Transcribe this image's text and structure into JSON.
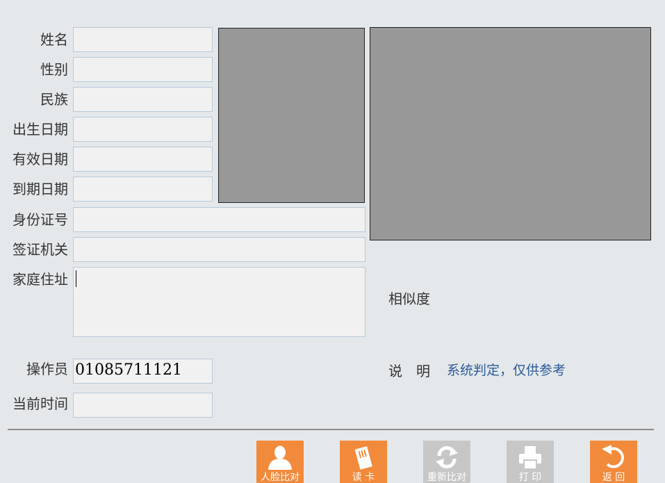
{
  "form": {
    "name_label": "姓名",
    "gender_label": "性别",
    "ethnicity_label": "民族",
    "birth_label": "出生日期",
    "valid_label": "有效日期",
    "expiry_label": "到期日期",
    "id_label": "身份证号",
    "issuer_label": "签证机关",
    "address_label": "家庭住址",
    "operator_label": "操作员",
    "operator_value": "01085711121",
    "time_label": "当前时间"
  },
  "compare": {
    "similarity_label": "相似度",
    "note_label": "说　明",
    "note_text": "系统判定，仅供参考"
  },
  "buttons": {
    "face_compare": "人脸比对",
    "read_card": "读 卡",
    "recompare": "重新比对",
    "print": "打 印",
    "back": "返 回"
  },
  "colors": {
    "accent_orange": "#f28a3b",
    "disabled_gray": "#c7c7c7",
    "hint_blue": "#2a5a9a",
    "background": "#e5e8ea"
  }
}
